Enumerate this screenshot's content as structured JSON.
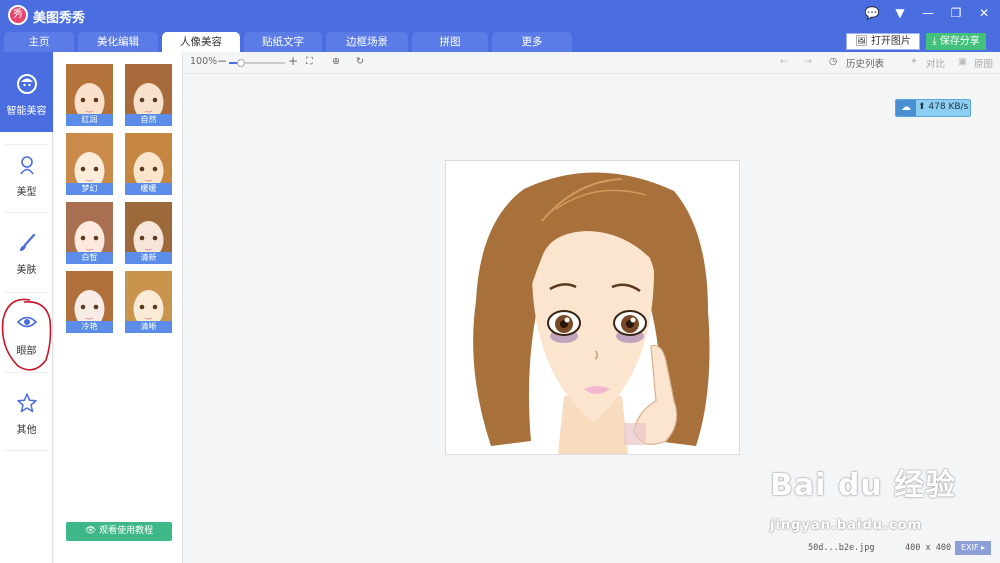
{
  "app": {
    "title": "美图秀秀",
    "logo_text": "秀"
  },
  "tabs": [
    "主页",
    "美化编辑",
    "人像美容",
    "贴纸文字",
    "边框场景",
    "拼图",
    "更多"
  ],
  "active_tab": "人像美容",
  "header_buttons": {
    "open": "打开图片",
    "save": "保存分享"
  },
  "nav": [
    {
      "label": "智能美容",
      "icon": "face-icon",
      "active": true
    },
    {
      "label": "美型",
      "icon": "person-icon",
      "active": false
    },
    {
      "label": "美肤",
      "icon": "brush-icon",
      "active": false
    },
    {
      "label": "眼部",
      "icon": "eye-icon",
      "active": false
    },
    {
      "label": "其他",
      "icon": "star-icon",
      "active": false
    }
  ],
  "presets": [
    "红润",
    "自然",
    "梦幻",
    "暖暖",
    "白皙",
    "清新",
    "冷艳",
    "清晰"
  ],
  "tutorial_button": "观看使用教程",
  "toolbar": {
    "zoom": "100%",
    "zoom_level": 0.22,
    "history": "历史列表",
    "compare": "对比",
    "original": "原图"
  },
  "speed": "478 KB/s",
  "status": {
    "filename": "50d...b2e.jpg",
    "size": "400 x 400",
    "exif": "EXIF"
  },
  "watermark": {
    "brand": "Bai du 经验",
    "url": "jingyan.baidu.com"
  },
  "colors": {
    "primary": "#4a6de0",
    "green": "#44c07d",
    "label_blue": "#5b8de8"
  }
}
